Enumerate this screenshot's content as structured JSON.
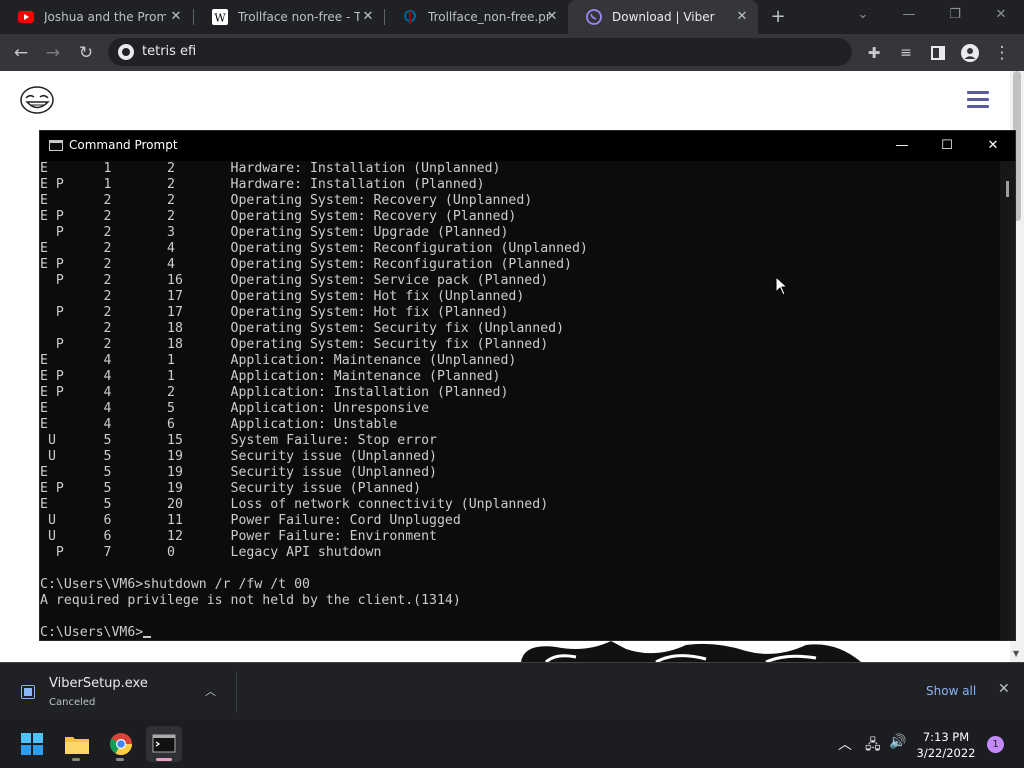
{
  "browser": {
    "tabs": [
      {
        "title": "Joshua and the Promise",
        "favicon": "youtube-icon"
      },
      {
        "title": "Trollface non-free - Trollface",
        "favicon": "wikipedia-icon"
      },
      {
        "title": "Trollface_non-free.png",
        "favicon": "wiki-commons-icon"
      },
      {
        "title": "Download | Viber",
        "favicon": "viber-icon",
        "active": true
      }
    ],
    "address": "tetris efi"
  },
  "cmd": {
    "title": "Command Prompt",
    "lines": [
      "E       1       2       Hardware: Installation (Unplanned)",
      "E P     1       2       Hardware: Installation (Planned)",
      "E       2       2       Operating System: Recovery (Unplanned)",
      "E P     2       2       Operating System: Recovery (Planned)",
      "  P     2       3       Operating System: Upgrade (Planned)",
      "E       2       4       Operating System: Reconfiguration (Unplanned)",
      "E P     2       4       Operating System: Reconfiguration (Planned)",
      "  P     2       16      Operating System: Service pack (Planned)",
      "        2       17      Operating System: Hot fix (Unplanned)",
      "  P     2       17      Operating System: Hot fix (Planned)",
      "        2       18      Operating System: Security fix (Unplanned)",
      "  P     2       18      Operating System: Security fix (Planned)",
      "E       4       1       Application: Maintenance (Unplanned)",
      "E P     4       1       Application: Maintenance (Planned)",
      "E P     4       2       Application: Installation (Planned)",
      "E       4       5       Application: Unresponsive",
      "E       4       6       Application: Unstable",
      " U      5       15      System Failure: Stop error",
      " U      5       19      Security issue (Unplanned)",
      "E       5       19      Security issue (Unplanned)",
      "E P     5       19      Security issue (Planned)",
      "E       5       20      Loss of network connectivity (Unplanned)",
      " U      6       11      Power Failure: Cord Unplugged",
      " U      6       12      Power Failure: Environment",
      "  P     7       0       Legacy API shutdown",
      "",
      "C:\\Users\\VM6>shutdown /r /fw /t 00",
      "A required privilege is not held by the client.(1314)",
      ""
    ],
    "prompt": "C:\\Users\\VM6>"
  },
  "download": {
    "file_name": "ViberSetup.exe",
    "status": "Canceled",
    "show_all": "Show all"
  },
  "taskbar": {
    "time": "7:13 PM",
    "date": "3/22/2022",
    "notifications": "1"
  }
}
